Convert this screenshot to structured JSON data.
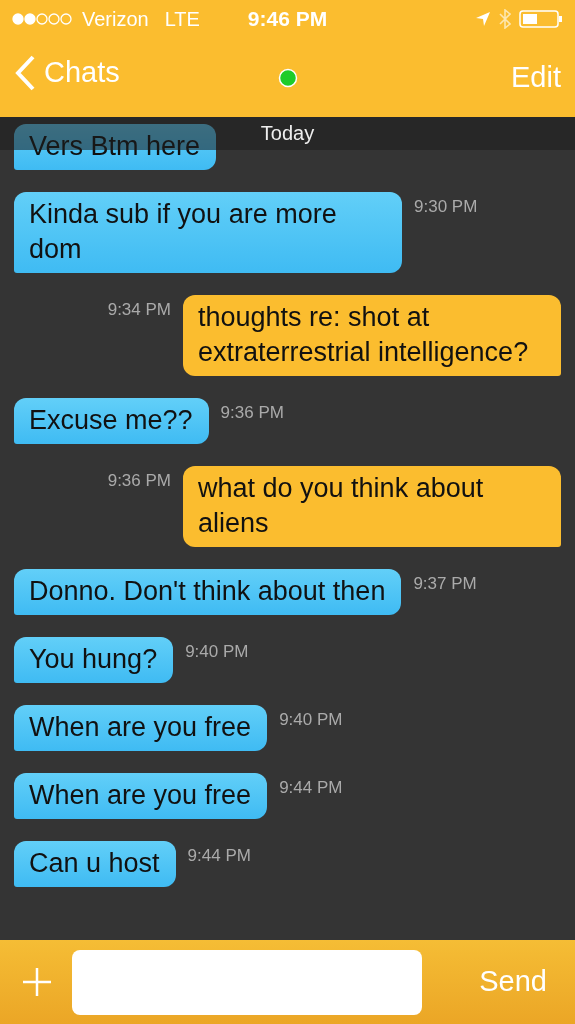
{
  "status_bar": {
    "carrier": "Verizon",
    "network": "LTE",
    "time": "9:46 PM"
  },
  "nav": {
    "back": "Chats",
    "online": true,
    "edit": "Edit"
  },
  "date_header": "Today",
  "messages": [
    {
      "kind": "received",
      "text": "Vers Btm here"
    },
    {
      "kind": "received",
      "text": "Kinda sub if you are more dom",
      "time": "9:30 PM"
    },
    {
      "kind": "sent",
      "text": "thoughts re: shot at extraterrestrial intelligence?",
      "time": "9:34 PM"
    },
    {
      "kind": "received",
      "text": "Excuse me??",
      "time": "9:36 PM"
    },
    {
      "kind": "sent",
      "text": "what do you think about aliens",
      "time": "9:36 PM"
    },
    {
      "kind": "received",
      "text": "Donno. Don't think about then",
      "time": "9:37 PM"
    },
    {
      "kind": "received",
      "text": "You hung?",
      "time": "9:40 PM"
    },
    {
      "kind": "received",
      "text": "When are you free",
      "time": "9:40 PM"
    },
    {
      "kind": "received",
      "text": "When are you free",
      "time": "9:44 PM"
    },
    {
      "kind": "received",
      "text": "Can u host",
      "time": "9:44 PM"
    }
  ],
  "composer": {
    "send": "Send"
  }
}
